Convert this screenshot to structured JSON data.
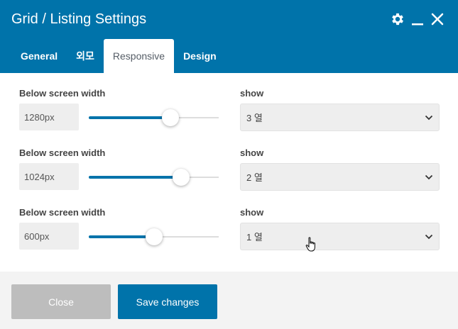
{
  "header": {
    "title": "Grid / Listing Settings",
    "bg_color": "#0073aa"
  },
  "icons": {
    "settings": "gear-icon",
    "minimize": "minimize-icon",
    "close": "close-icon"
  },
  "tabs": [
    {
      "label": "General",
      "active": false
    },
    {
      "label": "외모",
      "active": false
    },
    {
      "label": "Responsive",
      "active": true
    },
    {
      "label": "Design",
      "active": false
    }
  ],
  "rows": [
    {
      "label": "Below screen width",
      "value": "1280px",
      "slider_fraction": 0.63,
      "show_label": "show",
      "show_value": "3 열"
    },
    {
      "label": "Below screen width",
      "value": "1024px",
      "slider_fraction": 0.71,
      "show_label": "show",
      "show_value": "2 열"
    },
    {
      "label": "Below screen width",
      "value": "600px",
      "slider_fraction": 0.5,
      "show_label": "show",
      "show_value": "1 열"
    }
  ],
  "footer": {
    "close_label": "Close",
    "save_label": "Save changes"
  }
}
